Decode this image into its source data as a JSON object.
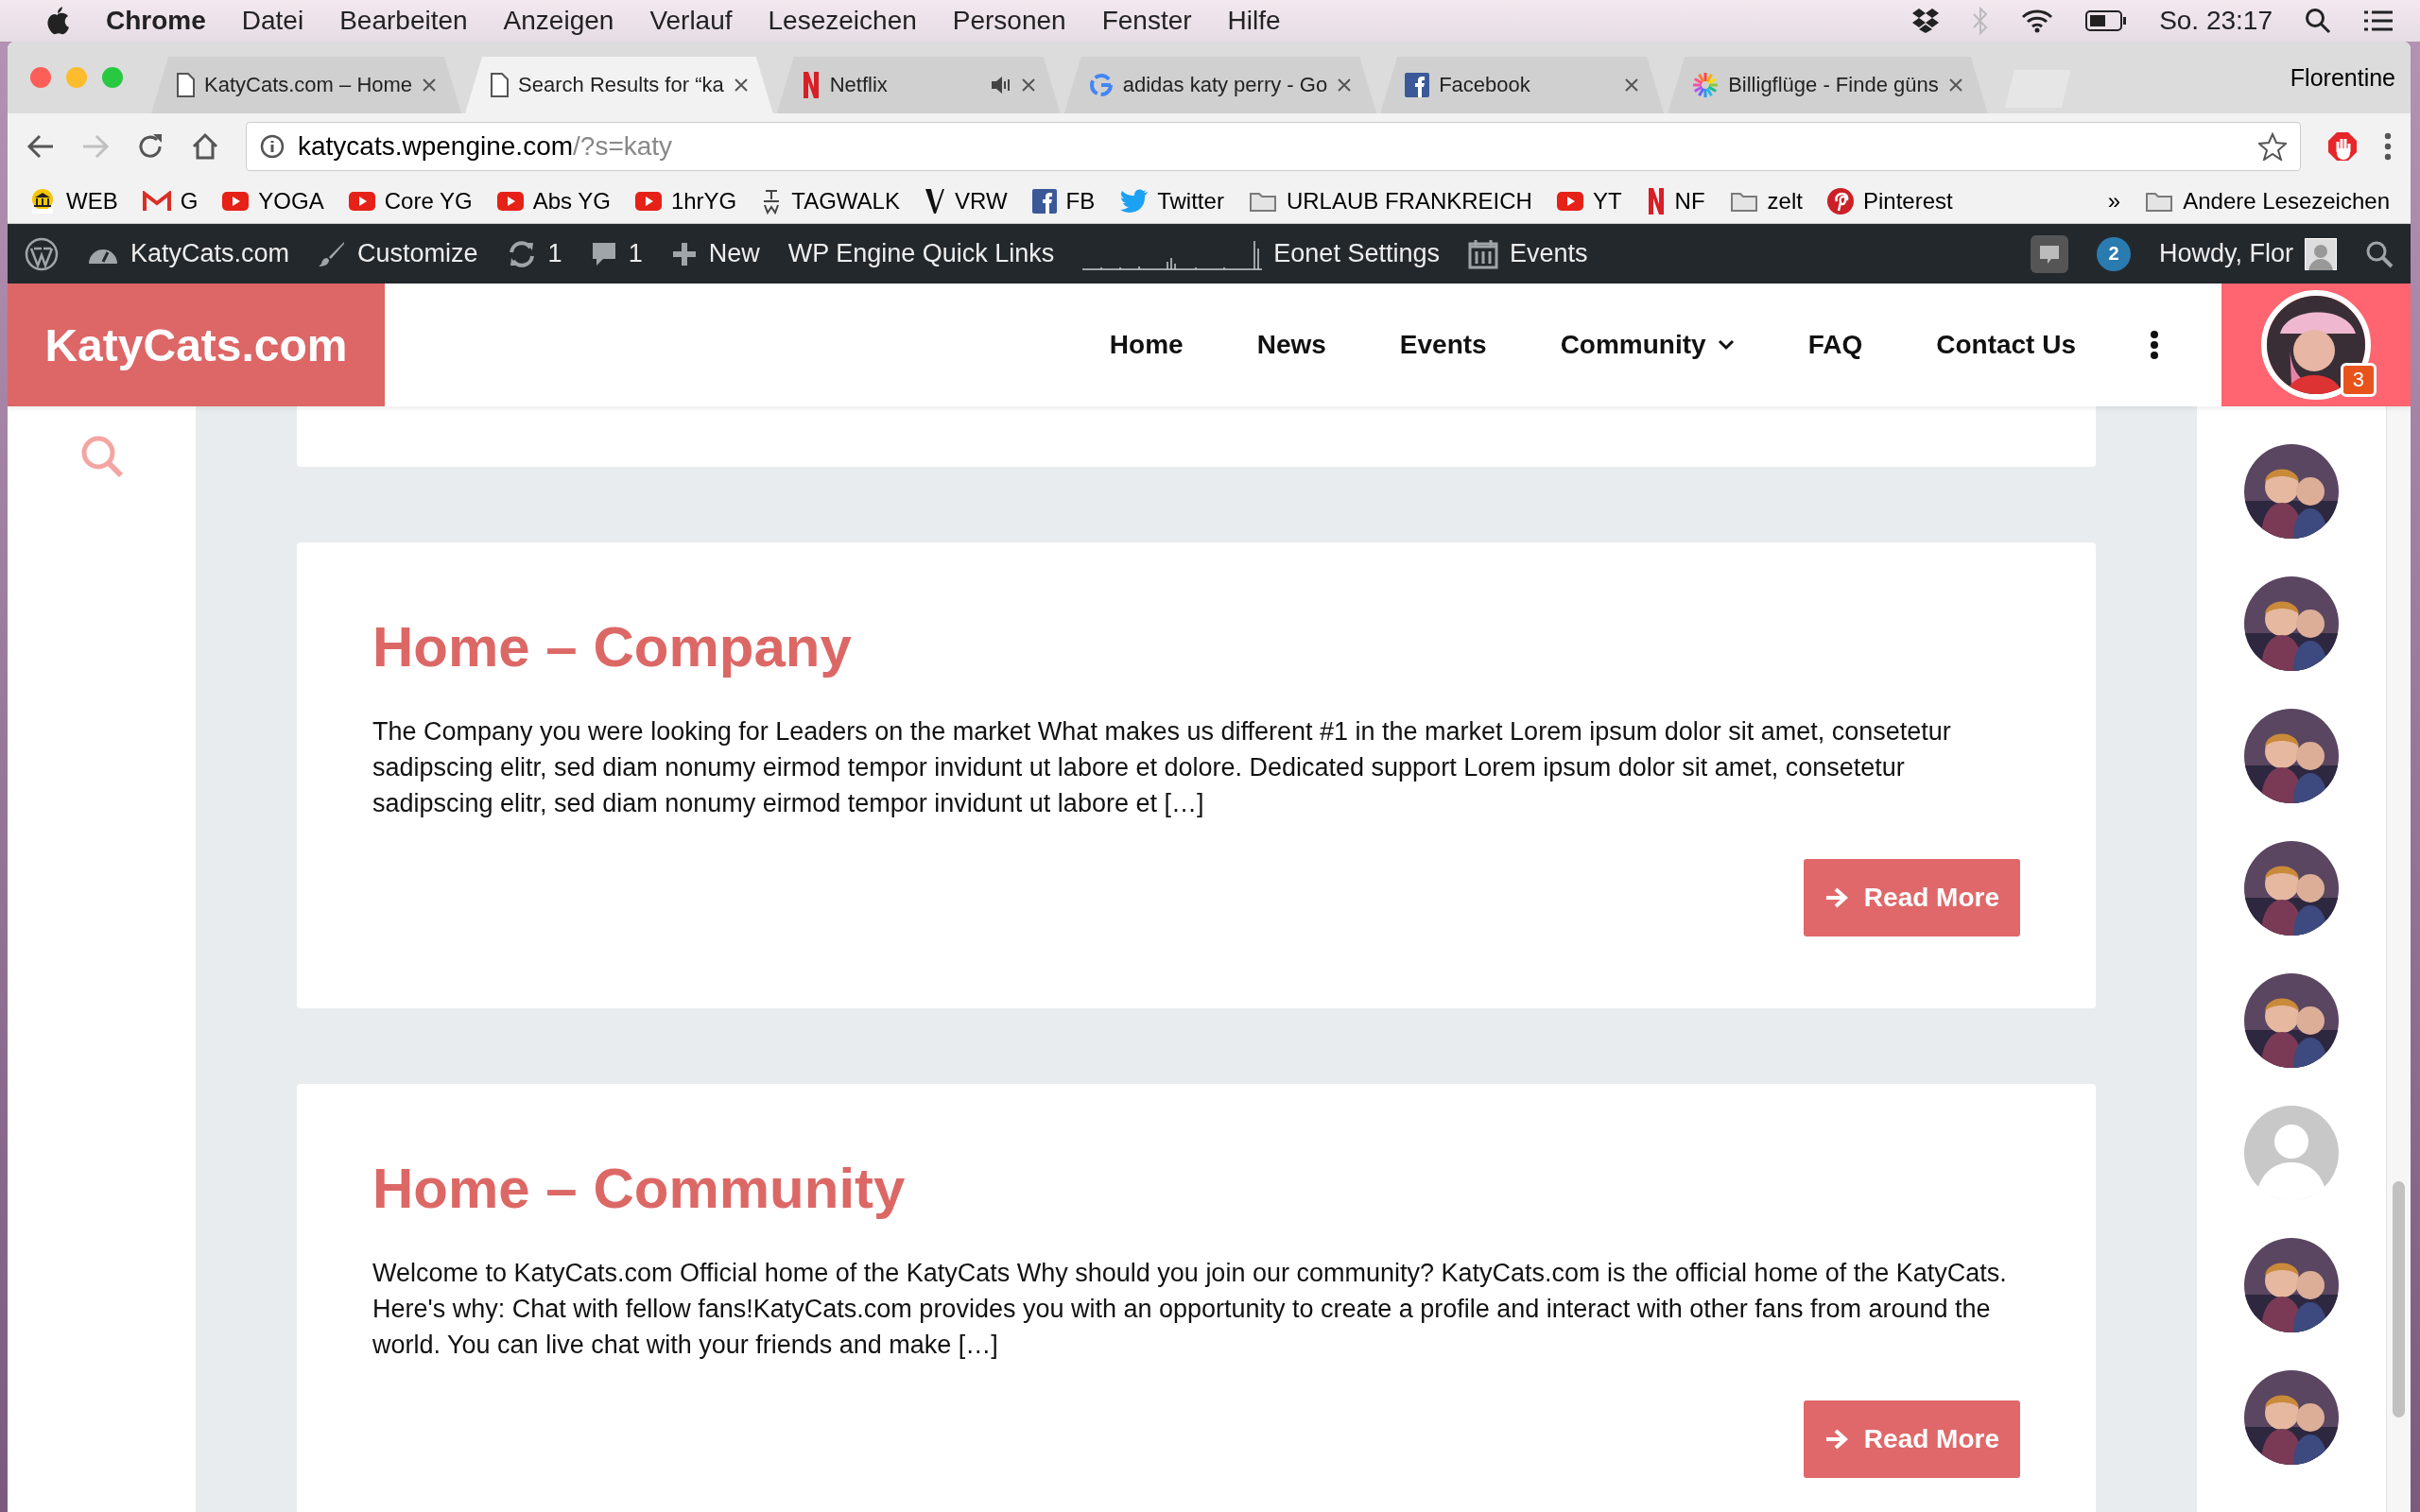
{
  "menu_bar": {
    "app": "Chrome",
    "items": [
      "Datei",
      "Bearbeiten",
      "Anzeigen",
      "Verlauf",
      "Lesezeichen",
      "Personen",
      "Fenster",
      "Hilfe"
    ],
    "clock": "So. 23:17"
  },
  "tabs": [
    {
      "title": "KatyCats.com – Home",
      "kind": "page",
      "selected": false,
      "audio": false
    },
    {
      "title": "Search Results for “ka",
      "kind": "page",
      "selected": true,
      "audio": false
    },
    {
      "title": "Netflix",
      "kind": "netflix",
      "selected": false,
      "audio": true
    },
    {
      "title": "adidas katy perry - Go",
      "kind": "google",
      "selected": false,
      "audio": false
    },
    {
      "title": "Facebook",
      "kind": "facebook",
      "selected": false,
      "audio": false
    },
    {
      "title": "Billigflüge - Finde güns",
      "kind": "flights",
      "selected": false,
      "audio": false
    }
  ],
  "profile": "Florentine",
  "address_bar": {
    "host": "katycats.wpengine.com",
    "path": "/?s=katy"
  },
  "bookmarks": [
    {
      "label": "WEB",
      "kind": "webde"
    },
    {
      "label": "G",
      "kind": "gmail"
    },
    {
      "label": "YOGA",
      "kind": "youtube"
    },
    {
      "label": "Core YG",
      "kind": "youtube"
    },
    {
      "label": "Abs YG",
      "kind": "youtube"
    },
    {
      "label": "1hrYG",
      "kind": "youtube"
    },
    {
      "label": "TAGWALK",
      "kind": "tagwalk"
    },
    {
      "label": "VRW",
      "kind": "vrw"
    },
    {
      "label": "FB",
      "kind": "facebook"
    },
    {
      "label": "Twitter",
      "kind": "twitter"
    },
    {
      "label": "URLAUB FRANKREICH",
      "kind": "folder"
    },
    {
      "label": "YT",
      "kind": "youtube"
    },
    {
      "label": "NF",
      "kind": "netflix"
    },
    {
      "label": "zelt",
      "kind": "folder"
    },
    {
      "label": "Pinterest",
      "kind": "pinterest"
    }
  ],
  "bookmarks_overflow": "»",
  "other_bookmarks": "Andere Lesezeichen",
  "admin_bar": {
    "items": [
      {
        "label": "KatyCats.com",
        "kind": "dashboard"
      },
      {
        "label": "Customize",
        "kind": "brush"
      },
      {
        "label": "1",
        "kind": "updates"
      },
      {
        "label": "1",
        "kind": "comments"
      },
      {
        "label": "New",
        "kind": "plus"
      },
      {
        "label": "WP Engine Quick Links",
        "kind": "text"
      },
      {
        "label": "Eonet Settings",
        "kind": "graph"
      },
      {
        "label": "Events",
        "kind": "calendar"
      }
    ],
    "notifications": "2",
    "greeting": "Howdy, Flor"
  },
  "site_header": {
    "logo": "KatyCats.com",
    "nav": [
      {
        "label": "Home",
        "dropdown": false
      },
      {
        "label": "News",
        "dropdown": false
      },
      {
        "label": "Events",
        "dropdown": false
      },
      {
        "label": "Community",
        "dropdown": true
      },
      {
        "label": "FAQ",
        "dropdown": false
      },
      {
        "label": "Contact Us",
        "dropdown": false
      }
    ],
    "badge": "3"
  },
  "results": [
    {
      "title": "Home – Company",
      "excerpt": "The Company you were looking for Leaders on the market What makes us different #1 in the market Lorem ipsum dolor sit amet, consetetur sadipscing elitr, sed diam nonumy eirmod tempor invidunt ut labore et dolore. Dedicated support Lorem ipsum dolor sit amet, consetetur sadipscing elitr, sed diam nonumy eirmod tempor invidunt ut labore et […]",
      "button": "Read More"
    },
    {
      "title": "Home – Community",
      "excerpt": "Welcome to KatyCats.com Official home of the KatyCats Why should you join our community? KatyCats.com is the official home of the KatyCats. Here's why: Chat with fellow fans!KatyCats.com provides you with an opportunity to create a profile and interact with other fans from around the world. You can live chat with your friends and make […]",
      "button": "Read More"
    }
  ],
  "members": [
    {
      "kind": "picture"
    },
    {
      "kind": "picture"
    },
    {
      "kind": "picture"
    },
    {
      "kind": "picture"
    },
    {
      "kind": "picture"
    },
    {
      "kind": "default"
    },
    {
      "kind": "picture"
    },
    {
      "kind": "picture"
    }
  ]
}
